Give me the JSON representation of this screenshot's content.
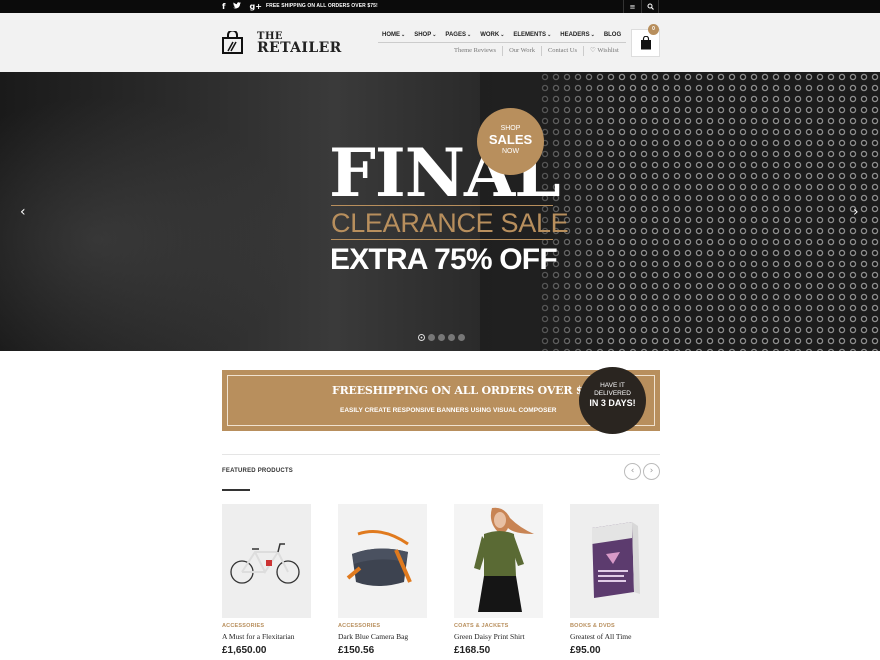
{
  "topbar": {
    "social_icons": [
      "facebook-icon",
      "twitter-icon",
      "google-plus-icon"
    ],
    "social_glyphs": [
      "f",
      "ᵂ",
      "g+"
    ],
    "promo": "FREE SHIPPING ON ALL ORDERS OVER $75!",
    "menu_glyph": "≡",
    "search_glyph": "⌕"
  },
  "header": {
    "logo_the": "THE",
    "logo_name": "RETAILER",
    "nav": [
      {
        "label": "HOME",
        "caret": "⌄"
      },
      {
        "label": "SHOP",
        "caret": "⌄"
      },
      {
        "label": "PAGES",
        "caret": "⌄"
      },
      {
        "label": "WORK",
        "caret": "⌄"
      },
      {
        "label": "ELEMENTS",
        "caret": "⌄"
      },
      {
        "label": "HEADERS",
        "caret": "⌄"
      },
      {
        "label": "BLOG",
        "caret": ""
      }
    ],
    "subnav": [
      "Theme Reviews",
      "Our Work",
      "Contact Us",
      "♡ Wishlist"
    ],
    "cart_count": "0"
  },
  "hero": {
    "prev": "‹",
    "next": "›",
    "headline": "FINAL",
    "subheadline": "CLEARANCE SALE",
    "offer": "EXTRA 75% OFF",
    "badge": {
      "line1": "SHOP",
      "line2": "SALES",
      "line3": "NOW"
    },
    "slides": 5,
    "active_slide": 1,
    "accent": "#b88f5d"
  },
  "banner": {
    "headline": "FREESHIPPING ON ALL ORDERS OVER $75",
    "sub": "EASILY CREATE RESPONSIVE BANNERS USING VISUAL COMPOSER",
    "circle": {
      "line1": "HAVE IT",
      "line2": "DELIVERED",
      "line3": "IN 3 DAYS!"
    }
  },
  "featured": {
    "title": "FEATURED PRODUCTS",
    "prev": "‹",
    "next": "›",
    "products": [
      {
        "category": "ACCESSORIES",
        "name": "A Must for a Flexitarian",
        "price": "£1,650.00",
        "image": "bicycle"
      },
      {
        "category": "ACCESSORIES",
        "name": "Dark Blue Camera Bag",
        "price": "£150.56",
        "image": "camera-bag"
      },
      {
        "category": "COATS & JACKETS",
        "name": "Green Daisy Print Shirt",
        "price": "£168.50",
        "image": "model-shirt"
      },
      {
        "category": "BOOKS & DVDS",
        "name": "Greatest of All Time",
        "price": "£95.00",
        "image": "book"
      }
    ]
  }
}
